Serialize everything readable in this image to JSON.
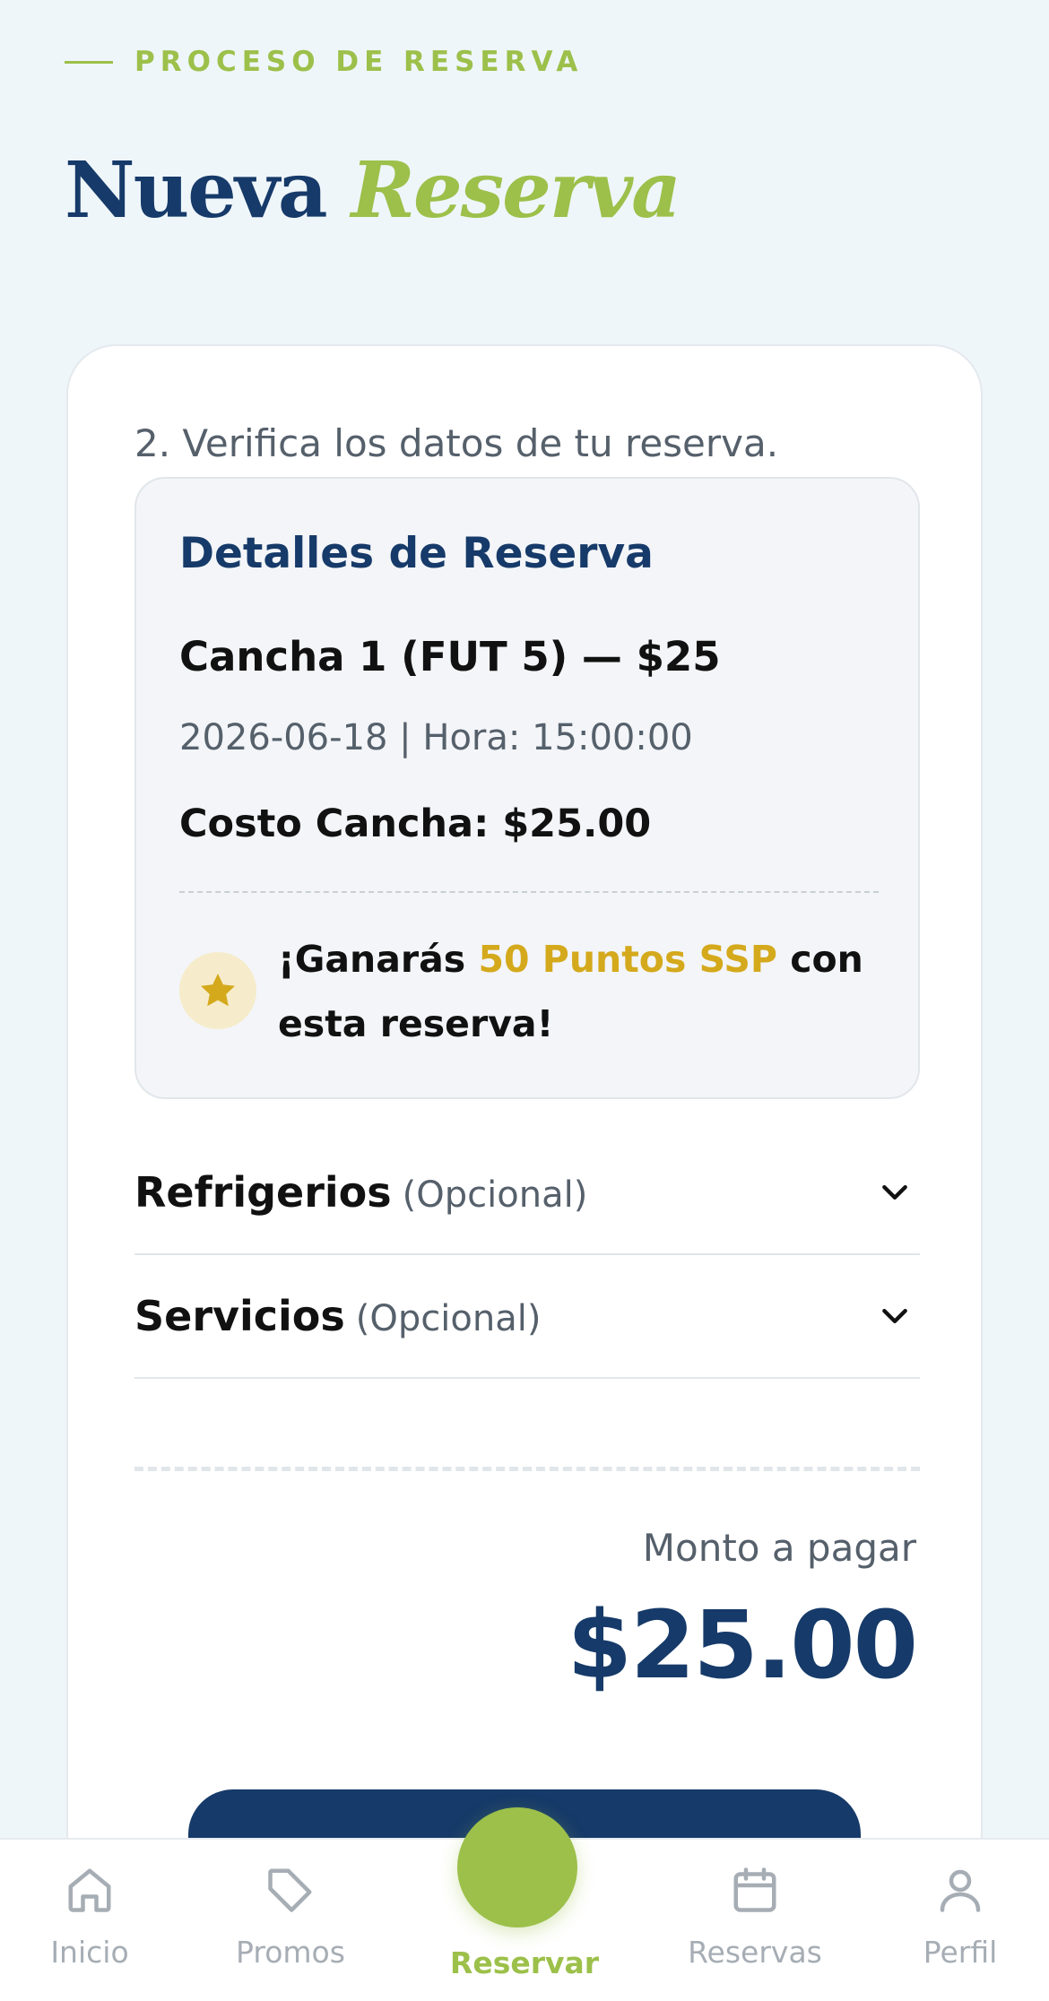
{
  "header": {
    "eyebrow": "PROCESO DE RESERVA",
    "title_main": "Nueva",
    "title_accent": "Reserva"
  },
  "card": {
    "step_label": "2. Verifica los datos de tu reserva.",
    "details": {
      "title": "Detalles de Reserva",
      "court": "Cancha 1 (FUT 5) — $25",
      "datetime": "2026-06-18 | Hora: 15:00:00",
      "court_cost": "Costo Cancha: $25.00",
      "points_prefix": "¡Ganarás ",
      "points_highlight": "50 Puntos SSP",
      "points_suffix": " con esta reserva!"
    },
    "accordions": [
      {
        "name": "Refrigerios",
        "optional": "(Opcional)"
      },
      {
        "name": "Servicios",
        "optional": "(Opcional)"
      }
    ],
    "amount_label": "Monto a pagar",
    "amount": "$25.00"
  },
  "nav": {
    "items": [
      {
        "label": "Inicio",
        "icon": "home-icon"
      },
      {
        "label": "Promos",
        "icon": "tag-icon"
      },
      {
        "label": "Reservar",
        "icon": "reserve-button"
      },
      {
        "label": "Reservas",
        "icon": "calendar-icon"
      },
      {
        "label": "Perfil",
        "icon": "user-icon"
      }
    ]
  },
  "colors": {
    "navy": "#163a69",
    "lime": "#9cc04a",
    "gold": "#d4a91c"
  }
}
